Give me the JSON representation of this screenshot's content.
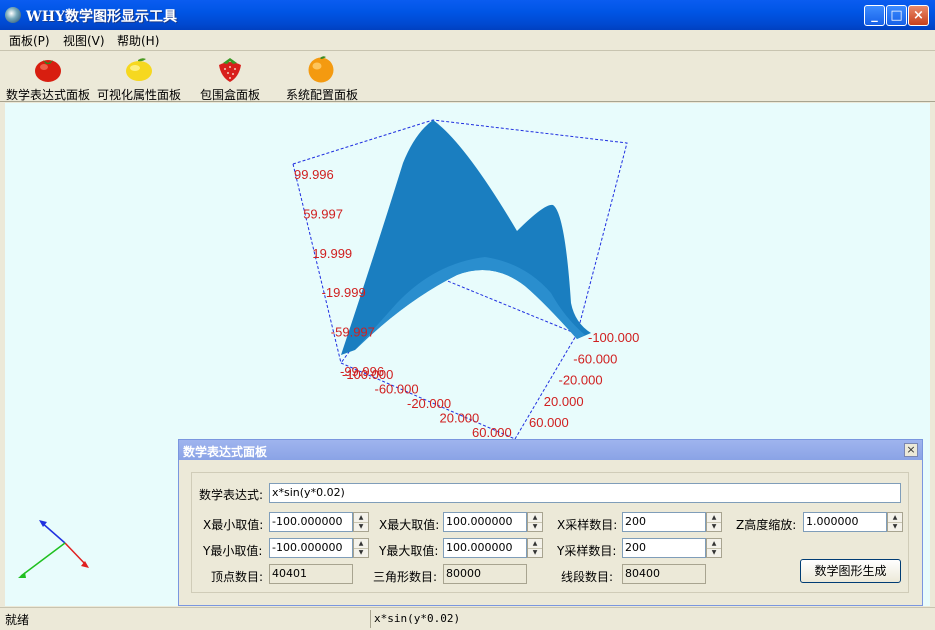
{
  "app": {
    "title": "WHY数学图形显示工具"
  },
  "window_controls": {
    "minimize": "_",
    "maximize": "□",
    "close": "×"
  },
  "menu": [
    "面板(P)",
    "视图(V)",
    "帮助(H)"
  ],
  "toolbar": [
    {
      "label": "数学表达式面板",
      "icon": "tomato-icon"
    },
    {
      "label": "可视化属性面板",
      "icon": "lemon-icon"
    },
    {
      "label": "包围盒面板",
      "icon": "strawberry-icon"
    },
    {
      "label": "系统配置面板",
      "icon": "orange-icon"
    }
  ],
  "plot": {
    "z_labels": [
      "99.996",
      "59.997",
      "19.999",
      "-19.999",
      "-59.997",
      "-99.996"
    ],
    "x_labels": [
      "-100.000",
      "-60.000",
      "-20.000",
      "20.000",
      "60.000"
    ],
    "y_labels": [
      "-100.000",
      "-60.000",
      "-20.000",
      "20.000",
      "60.000"
    ],
    "surface_color": "#1a7ec0",
    "box_color": "#1f2fe0",
    "label_color": "#d02020"
  },
  "panel": {
    "title": "数学表达式面板",
    "close": "×",
    "expression_label": "数学表达式:",
    "expression": "x*sin(y*0.02)",
    "x_min_label": "X最小取值:",
    "x_min": "-100.000000",
    "x_max_label": "X最大取值:",
    "x_max": "100.000000",
    "x_samples_label": "X采样数目:",
    "x_samples": "200",
    "z_scale_label": "Z高度缩放:",
    "z_scale": "1.000000",
    "y_min_label": "Y最小取值:",
    "y_min": "-100.000000",
    "y_max_label": "Y最大取值:",
    "y_max": "100.000000",
    "y_samples_label": "Y采样数目:",
    "y_samples": "200",
    "vertex_count_label": "顶点数目:",
    "vertex_count": "40401",
    "triangle_count_label": "三角形数目:",
    "triangle_count": "80000",
    "segment_count_label": "线段数目:",
    "segment_count": "80400",
    "generate_button": "数学图形生成"
  },
  "status": {
    "left": "就绪",
    "right": "x*sin(y*0.02)"
  }
}
